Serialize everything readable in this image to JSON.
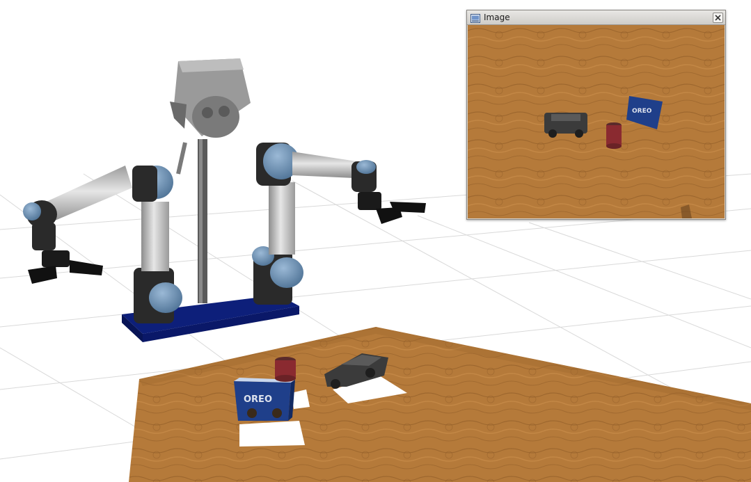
{
  "image_window": {
    "title": "Image",
    "icon": "image-window-icon",
    "close_icon": "close-icon"
  },
  "scene": {
    "robot": "dual-arm-robot",
    "objects": [
      "oreo-box",
      "toy-car",
      "red-jar"
    ],
    "table_surface": "wooden-table"
  },
  "colors": {
    "wood": "#b57a3a",
    "wood_dark": "#8e5a26",
    "robot_base": "#0d1f7a",
    "joint_blue": "#6f93b8",
    "link_gray": "#c9c9c9",
    "grid_line": "#d9d9d9"
  }
}
